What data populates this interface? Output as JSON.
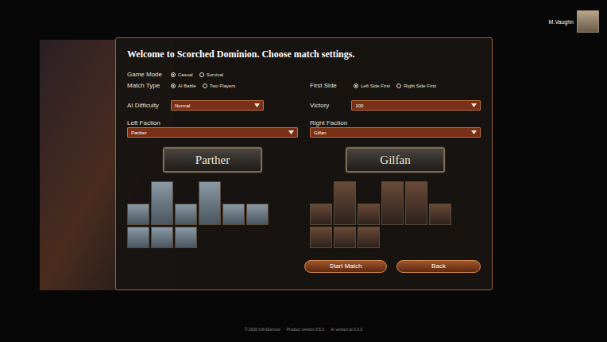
{
  "user": {
    "name": "M.Vaughn"
  },
  "title": "Welcome to Scorched Dominion. Choose match settings.",
  "settings": {
    "game_mode": {
      "label": "Game Mode",
      "options": [
        {
          "label": "Casual",
          "selected": true
        },
        {
          "label": "Survival",
          "selected": false
        }
      ]
    },
    "match_type": {
      "label": "Match Type",
      "options": [
        {
          "label": "AI Battle",
          "selected": true
        },
        {
          "label": "Two Players",
          "selected": false
        }
      ]
    },
    "first_side": {
      "label": "First Side",
      "options": [
        {
          "label": "Left Side First",
          "selected": true
        },
        {
          "label": "Right Side First",
          "selected": false
        }
      ]
    },
    "ai_difficulty": {
      "label": "AI Difficulty",
      "value": "Normal"
    },
    "victory": {
      "label": "Victory",
      "value": "100"
    }
  },
  "factions": [
    {
      "label": "Left Faction",
      "value": "Parther",
      "banner": "Parther",
      "portraits": [
        [
          {
            "kind": "small"
          },
          {
            "kind": "tall"
          },
          {
            "kind": "small"
          },
          {
            "kind": "tall"
          },
          {
            "kind": "small"
          },
          {
            "kind": "small"
          }
        ],
        [
          {
            "kind": "small"
          },
          {
            "kind": "small"
          },
          {
            "kind": "small"
          }
        ]
      ]
    },
    {
      "label": "Right Faction",
      "value": "Gilfan",
      "banner": "Gilfan",
      "portraits": [
        [
          {
            "kind": "small"
          },
          {
            "kind": "tall"
          },
          {
            "kind": "small"
          },
          {
            "kind": "tall"
          },
          {
            "kind": "tall"
          },
          {
            "kind": "small"
          }
        ],
        [
          {
            "kind": "small"
          },
          {
            "kind": "small"
          },
          {
            "kind": "small"
          }
        ]
      ]
    }
  ],
  "buttons": [
    "Start Match",
    "Back"
  ],
  "footer": [
    "© 2020 InfiniService",
    "Product version:0.5.0",
    "AI version:ai 0.3.0"
  ]
}
